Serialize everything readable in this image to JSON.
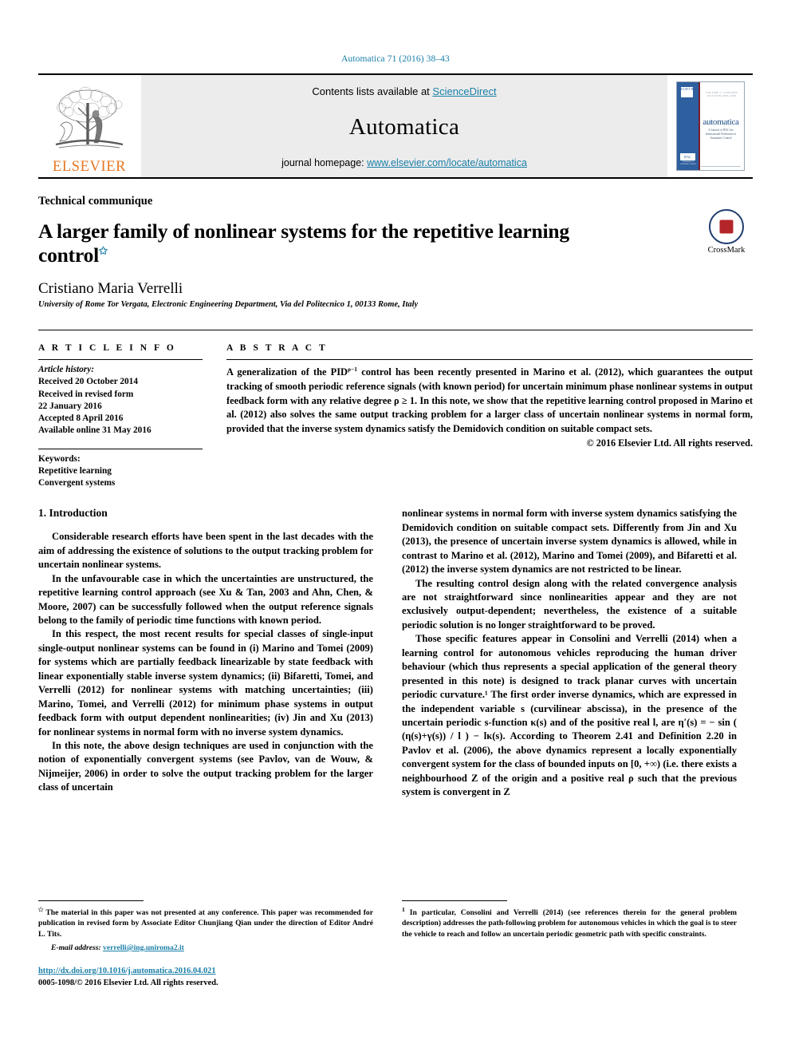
{
  "running_head": "Automatica 71 (2016) 38–43",
  "masthead": {
    "publisher_name": "ELSEVIER",
    "contents_prefix": "Contents lists available at ",
    "contents_link": "ScienceDirect",
    "journal_name": "Automatica",
    "homepage_prefix": "journal homepage: ",
    "homepage_link": "www.elsevier.com/locate/automatica",
    "cover": {
      "title": "automatica",
      "subtitle": "A Journal of IFAC the International Federation of Automatic Control",
      "top_rule": "VOLUME 71   JANUARY 2016   ISSN 0005-1098",
      "badge_left": "ELSEVIER",
      "ifac_mark": "IFAC"
    }
  },
  "article": {
    "kind": "Technical communique",
    "title": "A larger family of nonlinear systems for the repetitive learning control",
    "title_star": "✩",
    "author": "Cristiano Maria Verrelli",
    "affiliation": "University of Rome Tor Vergata, Electronic Engineering Department, Via del Politecnico 1, 00133 Rome, Italy",
    "crossmark_label": "CrossMark"
  },
  "info": {
    "heading": "A R T I C L E   I N F O",
    "history_label": "Article history:",
    "history": [
      "Received 20 October 2014",
      "Received in revised form",
      "22 January 2016",
      "Accepted 8 April 2016",
      "Available online 31 May 2016"
    ],
    "keywords_label": "Keywords:",
    "keywords": [
      "Repetitive learning",
      "Convergent systems"
    ]
  },
  "abstract": {
    "heading": "A B S T R A C T",
    "text_part1": "A generalization of the PID",
    "exponent": "ρ−1",
    "text_part2": " control has been recently presented in Marino et al. (2012), which guarantees the output tracking of smooth periodic reference signals (with known period) for uncertain minimum phase nonlinear systems in output feedback form with any relative degree ρ ≥ 1. In this note, we show that the repetitive learning control proposed in Marino et al. (2012) also solves the same output tracking problem for a larger class of uncertain nonlinear systems in normal form, provided that the inverse system dynamics satisfy the Demidovich condition on suitable compact sets.",
    "copyright": "© 2016 Elsevier Ltd. All rights reserved."
  },
  "body": {
    "section_number_title": "1. Introduction",
    "left_paragraphs": [
      "Considerable research efforts have been spent in the last decades with the aim of addressing the existence of solutions to the output tracking problem for uncertain nonlinear systems.",
      "In the unfavourable case in which the uncertainties are unstructured, the repetitive learning control approach (see Xu & Tan, 2003 and Ahn, Chen, & Moore, 2007) can be successfully followed when the output reference signals belong to the family of periodic time functions with known period.",
      "In this respect, the most recent results for special classes of single-input single-output nonlinear systems can be found in (i) Marino and Tomei (2009) for systems which are partially feedback linearizable by state feedback with linear exponentially stable inverse system dynamics; (ii) Bifaretti, Tomei, and Verrelli (2012) for nonlinear systems with matching uncertainties; (iii) Marino, Tomei, and Verrelli (2012) for minimum phase systems in output feedback form with output dependent nonlinearities; (iv) Jin and Xu (2013) for nonlinear systems in normal form with no inverse system dynamics.",
      "In this note, the above design techniques are used in conjunction with the notion of exponentially convergent systems (see Pavlov, van de Wouw, & Nijmeijer, 2006) in order to solve the output tracking problem for the larger class of uncertain"
    ],
    "right_paragraphs": [
      "nonlinear systems in normal form with inverse system dynamics satisfying the Demidovich condition on suitable compact sets. Differently from Jin and Xu (2013), the presence of uncertain inverse system dynamics is allowed, while in contrast to Marino et al. (2012), Marino and Tomei (2009), and Bifaretti et al. (2012) the inverse system dynamics are not restricted to be linear.",
      "The resulting control design along with the related convergence analysis are not straightforward since nonlinearities appear and they are not exclusively output-dependent; nevertheless, the existence of a suitable periodic solution is no longer straightforward to be proved.",
      "Those specific features appear in Consolini and Verrelli (2014) when a learning control for autonomous vehicles reproducing the human driver behaviour (which thus represents a special application of the general theory presented in this note) is designed to track planar curves with uncertain periodic curvature.¹ The first order inverse dynamics, which are expressed in the independent variable s (curvilinear abscissa), in the presence of the uncertain periodic s-function κ(s) and of the positive real l, are η′(s) = − sin ( (η(s)+γ(s)) / l ) − lκ(s). According to Theorem 2.41 and Definition 2.20 in Pavlov et al. (2006), the above dynamics represent a locally exponentially convergent system for the class of bounded inputs on [0, +∞) (i.e. there exists a neighbourhood Z of the origin and a positive real ρ such that the previous system is convergent in Z"
    ]
  },
  "footnotes": {
    "left_marker": "✩",
    "left_text": "The material in this paper was not presented at any conference. This paper was recommended for publication in revised form by Associate Editor Chunjiang Qian under the direction of Editor André L. Tits.",
    "email_label": "E-mail address:",
    "email": "verrelli@ing.uniroma2.it",
    "doi_url": "http://dx.doi.org/10.1016/j.automatica.2016.04.021",
    "issn_line": "0005-1098/© 2016 Elsevier Ltd. All rights reserved.",
    "right_marker": "1",
    "right_text": "In particular, Consolini and Verrelli (2014) (see references therein for the general problem description) addresses the path-following problem for autonomous vehicles in which the goal is to steer the vehicle to reach and follow an uncertain periodic geometric path with specific constraints."
  },
  "colors": {
    "link": "#1a7fa8",
    "elsevier_orange": "#E87722",
    "panel_gray": "#ececec"
  }
}
